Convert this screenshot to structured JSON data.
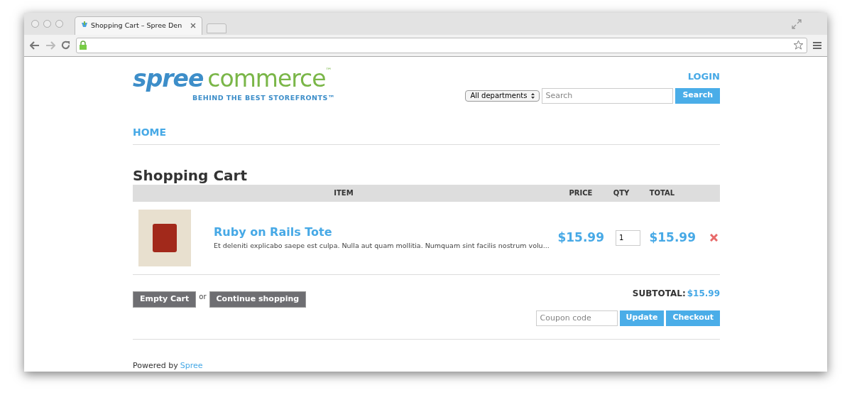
{
  "browser": {
    "tab_title": "Shopping Cart – Spree Den"
  },
  "logo": {
    "part_1": "spree",
    "part_2": "commerce",
    "mark": "™",
    "tagline": "BEHIND THE BEST STOREFRONTS™"
  },
  "header": {
    "login": "LOGIN",
    "department": "All departments",
    "search_placeholder": "Search",
    "search_button": "Search"
  },
  "nav": [
    {
      "label": "HOME"
    }
  ],
  "title": "Shopping Cart",
  "table": {
    "columns": [
      "ITEM",
      "PRICE",
      "QTY",
      "TOTAL"
    ],
    "rows": [
      {
        "name": "Ruby on Rails Tote",
        "description": "Et deleniti explicabo saepe est culpa. Nulla aut quam mollitia. Numquam sint facilis nostrum volu...",
        "price": "$15.99",
        "qty": "1",
        "total": "$15.99"
      }
    ]
  },
  "actions": {
    "empty": "Empty Cart",
    "or": "or",
    "continue": "Continue shopping"
  },
  "subtotal": {
    "label": "SUBTOTAL:",
    "value": "$15.99"
  },
  "coupon": {
    "placeholder": "Coupon code",
    "update": "Update",
    "checkout": "Checkout"
  },
  "footer": {
    "text": "Powered by",
    "link": "Spree"
  }
}
